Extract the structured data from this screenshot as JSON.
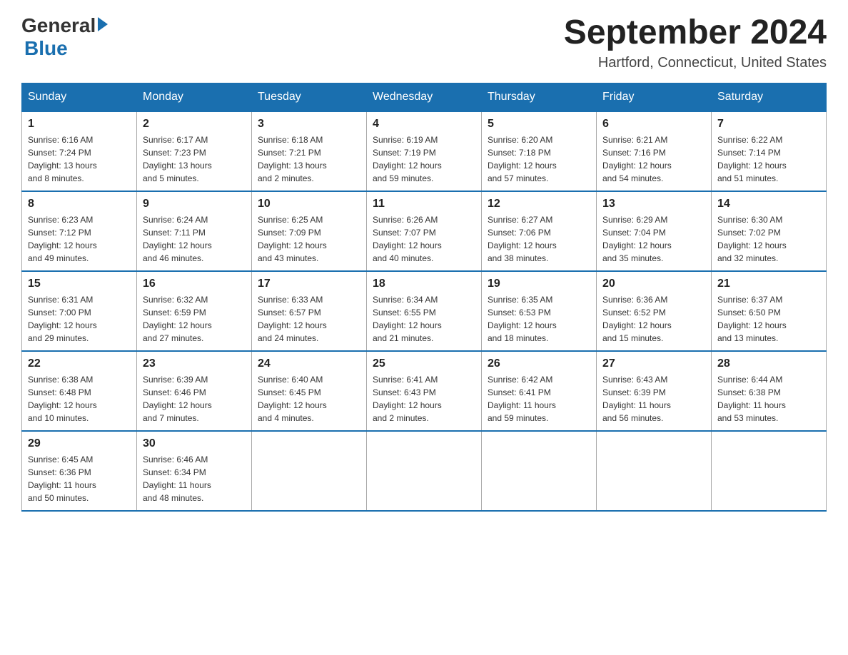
{
  "header": {
    "logo_general": "General",
    "logo_blue": "Blue",
    "month_year": "September 2024",
    "location": "Hartford, Connecticut, United States"
  },
  "days_of_week": [
    "Sunday",
    "Monday",
    "Tuesday",
    "Wednesday",
    "Thursday",
    "Friday",
    "Saturday"
  ],
  "weeks": [
    [
      {
        "day": "1",
        "sunrise": "6:16 AM",
        "sunset": "7:24 PM",
        "daylight": "13 hours and 8 minutes."
      },
      {
        "day": "2",
        "sunrise": "6:17 AM",
        "sunset": "7:23 PM",
        "daylight": "13 hours and 5 minutes."
      },
      {
        "day": "3",
        "sunrise": "6:18 AM",
        "sunset": "7:21 PM",
        "daylight": "13 hours and 2 minutes."
      },
      {
        "day": "4",
        "sunrise": "6:19 AM",
        "sunset": "7:19 PM",
        "daylight": "12 hours and 59 minutes."
      },
      {
        "day": "5",
        "sunrise": "6:20 AM",
        "sunset": "7:18 PM",
        "daylight": "12 hours and 57 minutes."
      },
      {
        "day": "6",
        "sunrise": "6:21 AM",
        "sunset": "7:16 PM",
        "daylight": "12 hours and 54 minutes."
      },
      {
        "day": "7",
        "sunrise": "6:22 AM",
        "sunset": "7:14 PM",
        "daylight": "12 hours and 51 minutes."
      }
    ],
    [
      {
        "day": "8",
        "sunrise": "6:23 AM",
        "sunset": "7:12 PM",
        "daylight": "12 hours and 49 minutes."
      },
      {
        "day": "9",
        "sunrise": "6:24 AM",
        "sunset": "7:11 PM",
        "daylight": "12 hours and 46 minutes."
      },
      {
        "day": "10",
        "sunrise": "6:25 AM",
        "sunset": "7:09 PM",
        "daylight": "12 hours and 43 minutes."
      },
      {
        "day": "11",
        "sunrise": "6:26 AM",
        "sunset": "7:07 PM",
        "daylight": "12 hours and 40 minutes."
      },
      {
        "day": "12",
        "sunrise": "6:27 AM",
        "sunset": "7:06 PM",
        "daylight": "12 hours and 38 minutes."
      },
      {
        "day": "13",
        "sunrise": "6:29 AM",
        "sunset": "7:04 PM",
        "daylight": "12 hours and 35 minutes."
      },
      {
        "day": "14",
        "sunrise": "6:30 AM",
        "sunset": "7:02 PM",
        "daylight": "12 hours and 32 minutes."
      }
    ],
    [
      {
        "day": "15",
        "sunrise": "6:31 AM",
        "sunset": "7:00 PM",
        "daylight": "12 hours and 29 minutes."
      },
      {
        "day": "16",
        "sunrise": "6:32 AM",
        "sunset": "6:59 PM",
        "daylight": "12 hours and 27 minutes."
      },
      {
        "day": "17",
        "sunrise": "6:33 AM",
        "sunset": "6:57 PM",
        "daylight": "12 hours and 24 minutes."
      },
      {
        "day": "18",
        "sunrise": "6:34 AM",
        "sunset": "6:55 PM",
        "daylight": "12 hours and 21 minutes."
      },
      {
        "day": "19",
        "sunrise": "6:35 AM",
        "sunset": "6:53 PM",
        "daylight": "12 hours and 18 minutes."
      },
      {
        "day": "20",
        "sunrise": "6:36 AM",
        "sunset": "6:52 PM",
        "daylight": "12 hours and 15 minutes."
      },
      {
        "day": "21",
        "sunrise": "6:37 AM",
        "sunset": "6:50 PM",
        "daylight": "12 hours and 13 minutes."
      }
    ],
    [
      {
        "day": "22",
        "sunrise": "6:38 AM",
        "sunset": "6:48 PM",
        "daylight": "12 hours and 10 minutes."
      },
      {
        "day": "23",
        "sunrise": "6:39 AM",
        "sunset": "6:46 PM",
        "daylight": "12 hours and 7 minutes."
      },
      {
        "day": "24",
        "sunrise": "6:40 AM",
        "sunset": "6:45 PM",
        "daylight": "12 hours and 4 minutes."
      },
      {
        "day": "25",
        "sunrise": "6:41 AM",
        "sunset": "6:43 PM",
        "daylight": "12 hours and 2 minutes."
      },
      {
        "day": "26",
        "sunrise": "6:42 AM",
        "sunset": "6:41 PM",
        "daylight": "11 hours and 59 minutes."
      },
      {
        "day": "27",
        "sunrise": "6:43 AM",
        "sunset": "6:39 PM",
        "daylight": "11 hours and 56 minutes."
      },
      {
        "day": "28",
        "sunrise": "6:44 AM",
        "sunset": "6:38 PM",
        "daylight": "11 hours and 53 minutes."
      }
    ],
    [
      {
        "day": "29",
        "sunrise": "6:45 AM",
        "sunset": "6:36 PM",
        "daylight": "11 hours and 50 minutes."
      },
      {
        "day": "30",
        "sunrise": "6:46 AM",
        "sunset": "6:34 PM",
        "daylight": "11 hours and 48 minutes."
      },
      null,
      null,
      null,
      null,
      null
    ]
  ],
  "labels": {
    "sunrise": "Sunrise:",
    "sunset": "Sunset:",
    "daylight": "Daylight:"
  }
}
